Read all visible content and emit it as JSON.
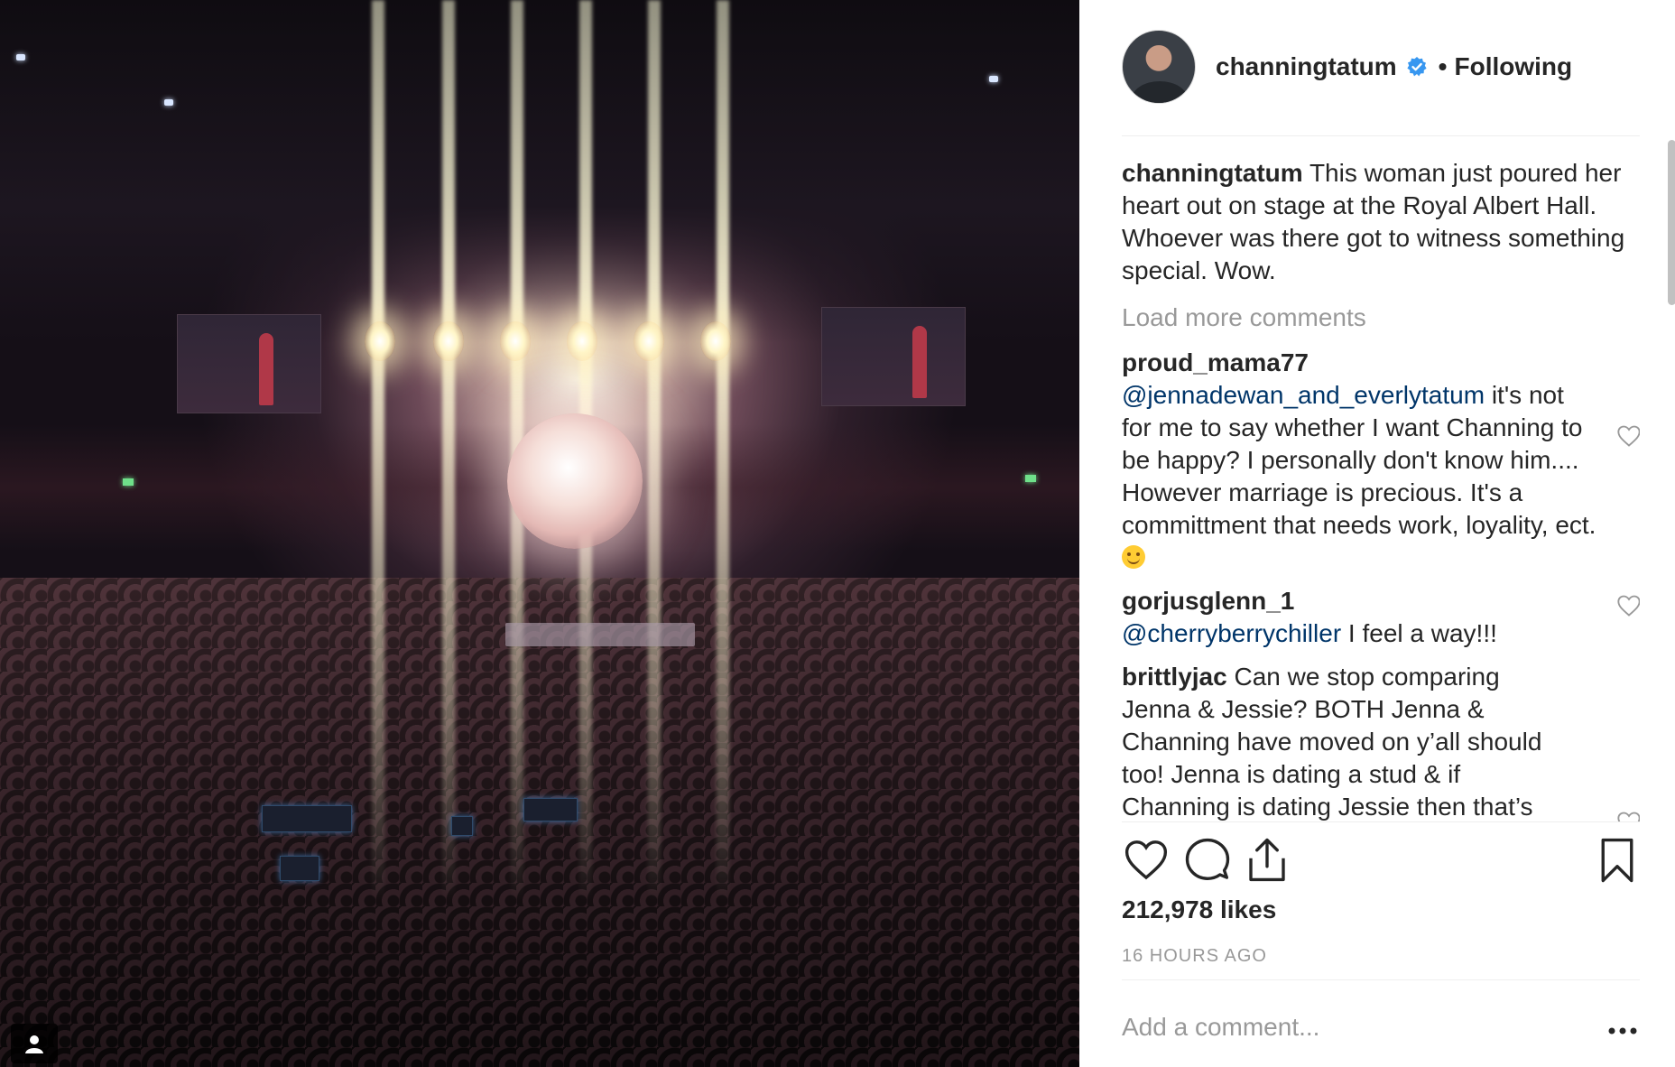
{
  "post": {
    "author": "channingtatum",
    "follow_status": "Following",
    "separator": "•",
    "caption": "This woman just poured her heart out on stage at the Royal Albert Hall. Whoever was there got to witness something special. Wow.",
    "load_more": "Load more comments",
    "comments": [
      {
        "user": "proud_mama77",
        "mention": "@jennadewan_and_everlytatum",
        "text": "it's not for me to say whether I want Channing to be happy? I personally don't know him.... However marriage is precious. It's a committment that needs work, loyality, ect."
      },
      {
        "user": "gorjusglenn_1",
        "mention": "@cherryberrychiller",
        "text": "I feel a way!!!"
      },
      {
        "user": "brittlyjac",
        "mention": "",
        "text": "Can we stop comparing Jenna & Jessie? BOTH Jenna & Channing have moved on y’all should too! Jenna is dating a stud & if Channing is dating Jessie then that’s great but it’s THEIR business not"
      }
    ],
    "likes": "212,978 likes",
    "time": "16 HOURS AGO",
    "add_comment_placeholder": "Add a comment..."
  },
  "icons": {
    "verified": "verified-badge-icon",
    "like": "heart-icon",
    "comment": "comment-bubble-icon",
    "share": "share-upload-icon",
    "save": "bookmark-icon",
    "more": "ellipsis-icon",
    "tagged": "user-tag-icon"
  },
  "colors": {
    "text": "#262626",
    "muted": "#999999",
    "mention": "#003569",
    "verified": "#3897f0",
    "divider": "#efefef"
  }
}
